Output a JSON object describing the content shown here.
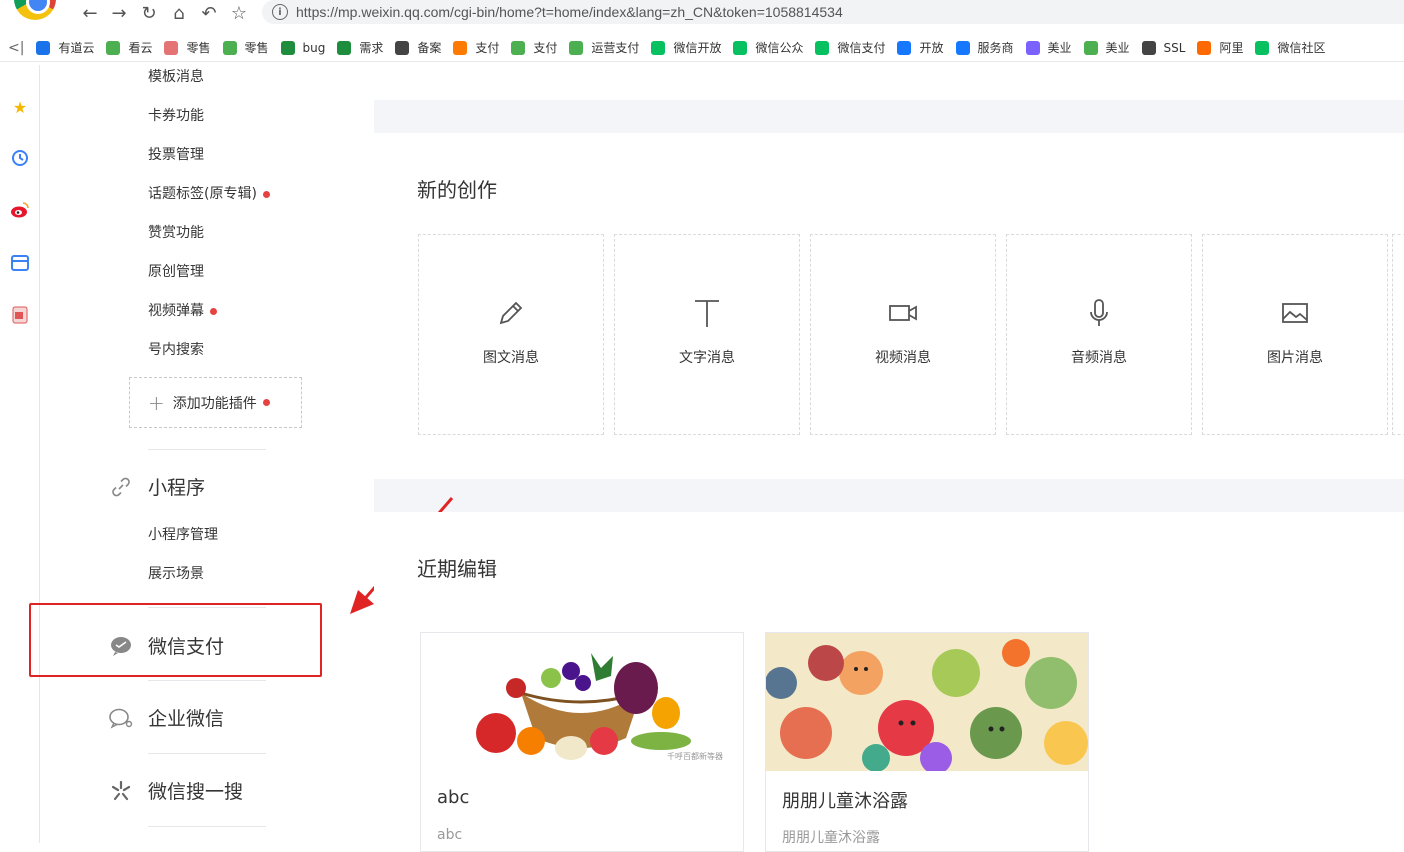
{
  "browser": {
    "url": "https://mp.weixin.qq.com/cgi-bin/home?t=home/index&lang=zh_CN&token=1058814534",
    "bookmarks": [
      {
        "label": "有道云",
        "color": "#1a73e8"
      },
      {
        "label": "看云",
        "color": "#4caf50"
      },
      {
        "label": "零售",
        "color": "#e57373"
      },
      {
        "label": "零售",
        "color": "#4caf50"
      },
      {
        "label": "bug",
        "color": "#1e8e3e"
      },
      {
        "label": "需求",
        "color": "#1e8e3e"
      },
      {
        "label": "备案",
        "color": "#444444"
      },
      {
        "label": "支付",
        "color": "#ff7a00"
      },
      {
        "label": "支付",
        "color": "#4caf50"
      },
      {
        "label": "运营支付",
        "color": "#4caf50"
      },
      {
        "label": "微信开放",
        "color": "#07c160"
      },
      {
        "label": "微信公众",
        "color": "#07c160"
      },
      {
        "label": "微信支付",
        "color": "#07c160"
      },
      {
        "label": "开放",
        "color": "#1677ff"
      },
      {
        "label": "服务商",
        "color": "#1677ff"
      },
      {
        "label": "美业",
        "color": "#7b61ff"
      },
      {
        "label": "美业",
        "color": "#4caf50"
      },
      {
        "label": "SSL",
        "color": "#444444"
      },
      {
        "label": "阿里",
        "color": "#ff6a00"
      },
      {
        "label": "微信社区",
        "color": "#07c160"
      }
    ]
  },
  "menu": {
    "plugins": [
      {
        "label": "模板消息",
        "dot": false
      },
      {
        "label": "卡券功能",
        "dot": false
      },
      {
        "label": "投票管理",
        "dot": false
      },
      {
        "label": "话题标签(原专辑)",
        "dot": true
      },
      {
        "label": "赞赏功能",
        "dot": false
      },
      {
        "label": "原创管理",
        "dot": false
      },
      {
        "label": "视频弹幕",
        "dot": true
      },
      {
        "label": "号内搜索",
        "dot": false
      }
    ],
    "add_plugin": "添加功能插件",
    "miniprogram": {
      "title": "小程序",
      "items": [
        "小程序管理",
        "展示场景"
      ]
    },
    "wechat_pay": "微信支付",
    "work_wechat": "企业微信",
    "search": "微信搜一搜"
  },
  "create": {
    "title": "新的创作",
    "items": [
      {
        "label": "图文消息",
        "icon": "pencil-icon"
      },
      {
        "label": "文字消息",
        "icon": "text-icon"
      },
      {
        "label": "视频消息",
        "icon": "video-icon"
      },
      {
        "label": "音频消息",
        "icon": "microphone-icon"
      },
      {
        "label": "图片消息",
        "icon": "image-icon"
      }
    ]
  },
  "recent": {
    "title": "近期编辑",
    "items": [
      {
        "title": "abc",
        "desc": "abc"
      },
      {
        "title": "朋朋儿童沐浴露",
        "desc": "朋朋儿童沐浴露"
      }
    ]
  },
  "colors": {
    "accent_red": "#e02424",
    "dot_red": "#e64340",
    "bg": "#f4f5f9"
  }
}
